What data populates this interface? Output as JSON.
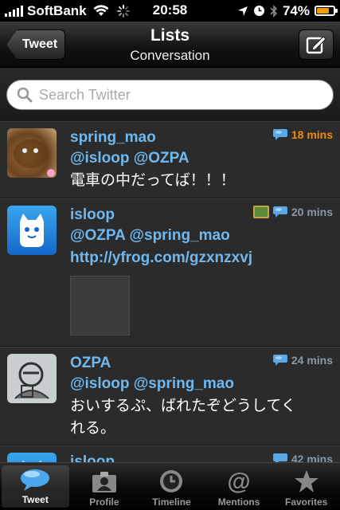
{
  "status_bar": {
    "carrier": "SoftBank",
    "time": "20:58",
    "battery": "74%",
    "battery_level": 0.74
  },
  "navbar": {
    "back_label": "Tweet",
    "title": "Lists",
    "subtitle": "Conversation"
  },
  "search": {
    "placeholder": "Search Twitter"
  },
  "tweets": [
    {
      "name": "spring_mao",
      "mentions": "@isloop @OZPA",
      "text": "電車の中だってば！！！",
      "time": "18",
      "time_unit": "mins"
    },
    {
      "name": "isloop",
      "mentions": "@OZPA @spring_mao",
      "link": "http://yfrog.com/gzxnzxvj",
      "time": "20",
      "time_unit": "mins"
    },
    {
      "name": "OZPA",
      "mentions": "@isloop @spring_mao",
      "text_line1": "おいするぷ、ばれたぞどうしてく",
      "text_line2": "れる。",
      "time": "24",
      "time_unit": "mins"
    },
    {
      "name": "isloop",
      "time": "42",
      "time_unit": "mins"
    }
  ],
  "tabs": [
    {
      "label": "Tweet",
      "active": true
    },
    {
      "label": "Profile"
    },
    {
      "label": "Timeline"
    },
    {
      "label": "Mentions"
    },
    {
      "label": "Favorites"
    }
  ],
  "colors": {
    "accent": "#6fb8f0",
    "new_time": "#f08a00",
    "battery": "#f0a000"
  }
}
